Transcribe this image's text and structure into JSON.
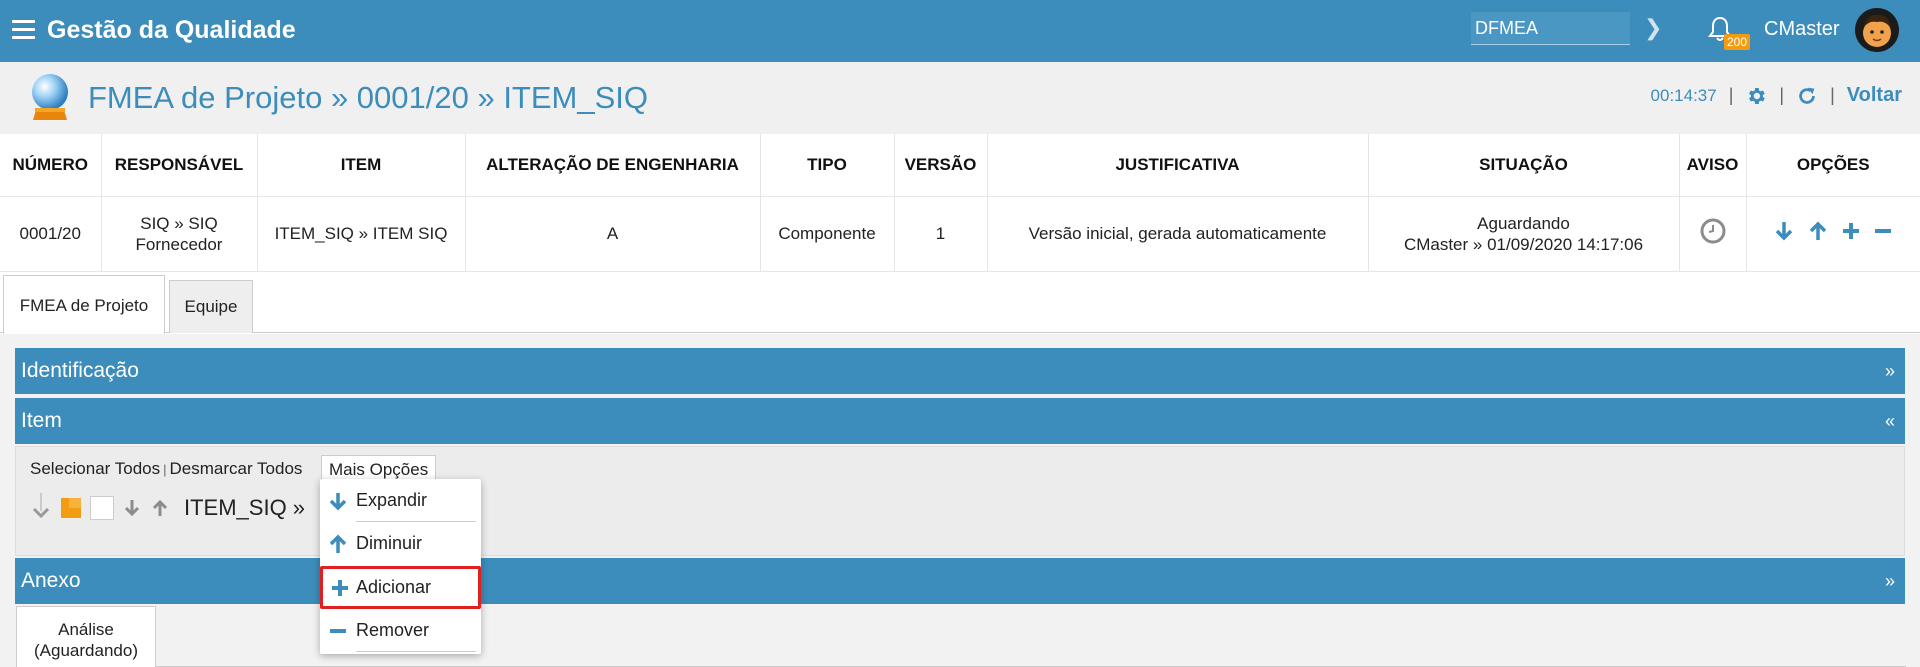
{
  "topbar": {
    "app_title": "Gestão da Qualidade",
    "module_select": "DFMEA",
    "notifications_count": "200",
    "user_name": "CMaster"
  },
  "header": {
    "title": "FMEA de Projeto » 0001/20 » ITEM_SIQ",
    "timer": "00:14:37",
    "back_label": "Voltar"
  },
  "summary": {
    "headers": [
      "NÚMERO",
      "RESPONSÁVEL",
      "ITEM",
      "ALTERAÇÃO DE ENGENHARIA",
      "TIPO",
      "VERSÃO",
      "JUSTIFICATIVA",
      "SITUAÇÃO",
      "AVISO",
      "OPÇÕES"
    ],
    "row": {
      "numero": "0001/20",
      "responsavel_1": "SIQ » SIQ",
      "responsavel_2": "Fornecedor",
      "item": "ITEM_SIQ » ITEM SIQ",
      "alteracao": "A",
      "tipo": "Componente",
      "versao": "1",
      "justificativa": "Versão inicial, gerada automaticamente",
      "situacao_1": "Aguardando",
      "situacao_2": "CMaster » 01/09/2020 14:17:06"
    }
  },
  "tabs": [
    "FMEA de Projeto",
    "Equipe"
  ],
  "sections": {
    "identificacao": "Identificação",
    "item": "Item",
    "anexo": "Anexo",
    "collapsed_symbol": "»",
    "expanded_symbol": "«"
  },
  "item_area": {
    "select_all": "Selecionar Todos",
    "deselect_all": "Desmarcar Todos",
    "more_options": "Mais Opções",
    "tree_text": "ITEM_SIQ »"
  },
  "dropdown": {
    "items": [
      "Expandir",
      "Diminuir",
      "Adicionar",
      "Remover"
    ],
    "highlighted": "Adicionar"
  },
  "sub_tab": {
    "line1": "Análise",
    "line2": "(Aguardando)"
  },
  "colors": {
    "brand": "#3c8dbc",
    "highlight_border": "#e0201e",
    "badge": "#f39c12"
  }
}
